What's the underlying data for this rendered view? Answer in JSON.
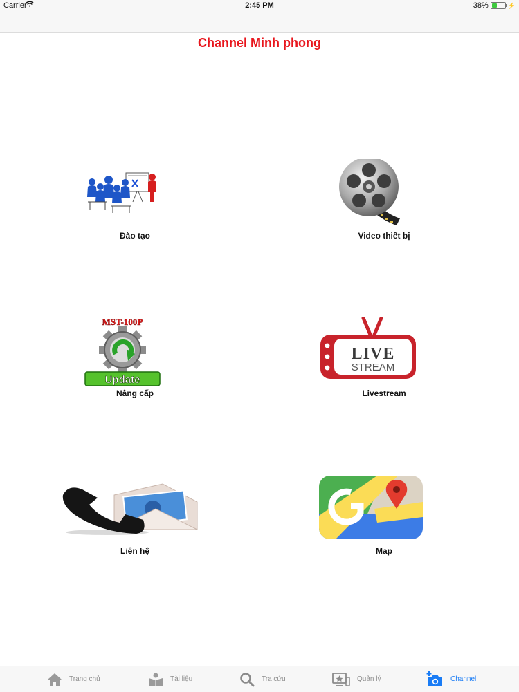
{
  "status_bar": {
    "carrier": "Carrier",
    "time": "2:45 PM",
    "battery": "38%",
    "battery_level": 0.38
  },
  "header": {
    "title": "Channel Minh phong"
  },
  "tiles": [
    {
      "label": "Đào tạo",
      "icon": "training-icon"
    },
    {
      "label": "Video thiết bị",
      "icon": "film-reel-icon"
    },
    {
      "label": "Nâng cấp",
      "icon": "update-gear-icon",
      "icon_text_top": "MST-100P",
      "icon_text_bottom": "Update"
    },
    {
      "label": "Livestream",
      "icon": "live-stream-tv-icon",
      "icon_text_top": "LIVE",
      "icon_text_bottom": "STREAM"
    },
    {
      "label": "Liên hệ",
      "icon": "phone-mail-icon"
    },
    {
      "label": "Map",
      "icon": "google-maps-icon"
    }
  ],
  "tab_bar": {
    "items": [
      {
        "label": "Trang chủ",
        "icon": "home-icon"
      },
      {
        "label": "Tài liệu",
        "icon": "reader-book-icon"
      },
      {
        "label": "Tra cứu",
        "icon": "search-icon"
      },
      {
        "label": "Quản lý",
        "icon": "monitor-star-icon"
      },
      {
        "label": "Channel",
        "icon": "camera-add-icon",
        "active": true
      }
    ]
  },
  "colors": {
    "title": "#e8161d",
    "tab_active": "#1a7cf5",
    "tab_inactive": "#8e8e8e",
    "battery": "#3ec93e"
  }
}
